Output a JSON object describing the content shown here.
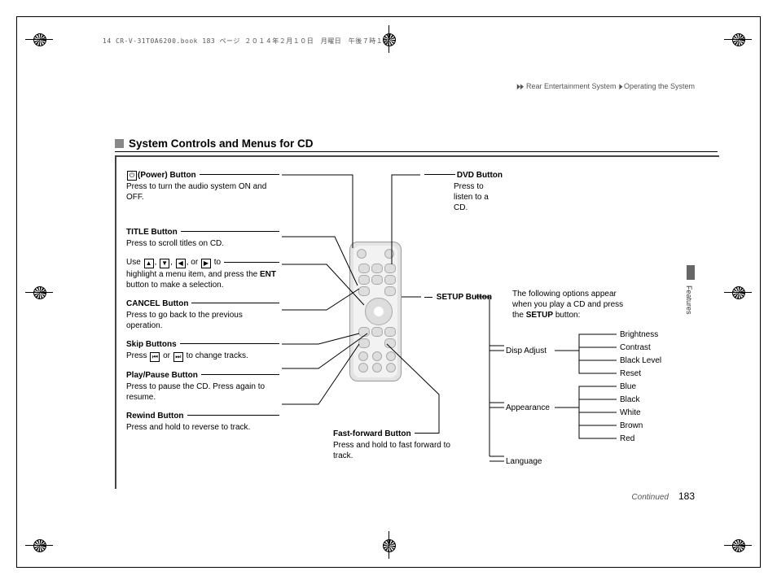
{
  "file_header": "14 CR-V-31T0A6200.book  183 ページ  ２０１４年２月１０日　月曜日　午後７時１分",
  "breadcrumb": {
    "a": "Rear Entertainment System",
    "sep": "▶",
    "b": "Operating the System"
  },
  "section_title": "System Controls and Menus for CD",
  "side_tab": "Features",
  "page_number": "183",
  "continued": "Continued",
  "labels": {
    "power": {
      "title": "(Power) Button",
      "desc": "Press to turn the audio system ON and OFF."
    },
    "title_btn": {
      "title": "TITLE Button",
      "desc": "Press to scroll titles on CD."
    },
    "nav": {
      "line1_a": "Use",
      "line1_b": ", or",
      "line1_c": "to",
      "line2": "highlight a menu item, and press the",
      "ent": "ENT",
      "line3": "button to make a selection."
    },
    "cancel": {
      "title": "CANCEL Button",
      "desc": "Press to go back to the previous operation."
    },
    "skip": {
      "title": "Skip Buttons",
      "desc_a": "Press",
      "desc_b": "or",
      "desc_c": "to change tracks."
    },
    "playpause": {
      "title": "Play/Pause Button",
      "desc": "Press to pause the CD. Press again to resume."
    },
    "rewind": {
      "title": "Rewind Button",
      "desc": "Press and hold to reverse to track."
    },
    "ff": {
      "title": "Fast-forward Button",
      "desc": "Press and hold to fast forward to track."
    },
    "dvd": {
      "title": "DVD Button",
      "desc": "Press to listen to a CD."
    },
    "setup": {
      "title": "SETUP Button"
    }
  },
  "menu": {
    "intro_a": "The following options appear when you play a CD and press the",
    "intro_b": "SETUP",
    "intro_c": "button:",
    "level1": [
      "Disp Adjust",
      "Appearance",
      "Language"
    ],
    "disp_adjust_children": [
      "Brightness",
      "Contrast",
      "Black Level",
      "Reset"
    ],
    "appearance_children": [
      "Blue",
      "Black",
      "White",
      "Brown",
      "Red"
    ]
  }
}
